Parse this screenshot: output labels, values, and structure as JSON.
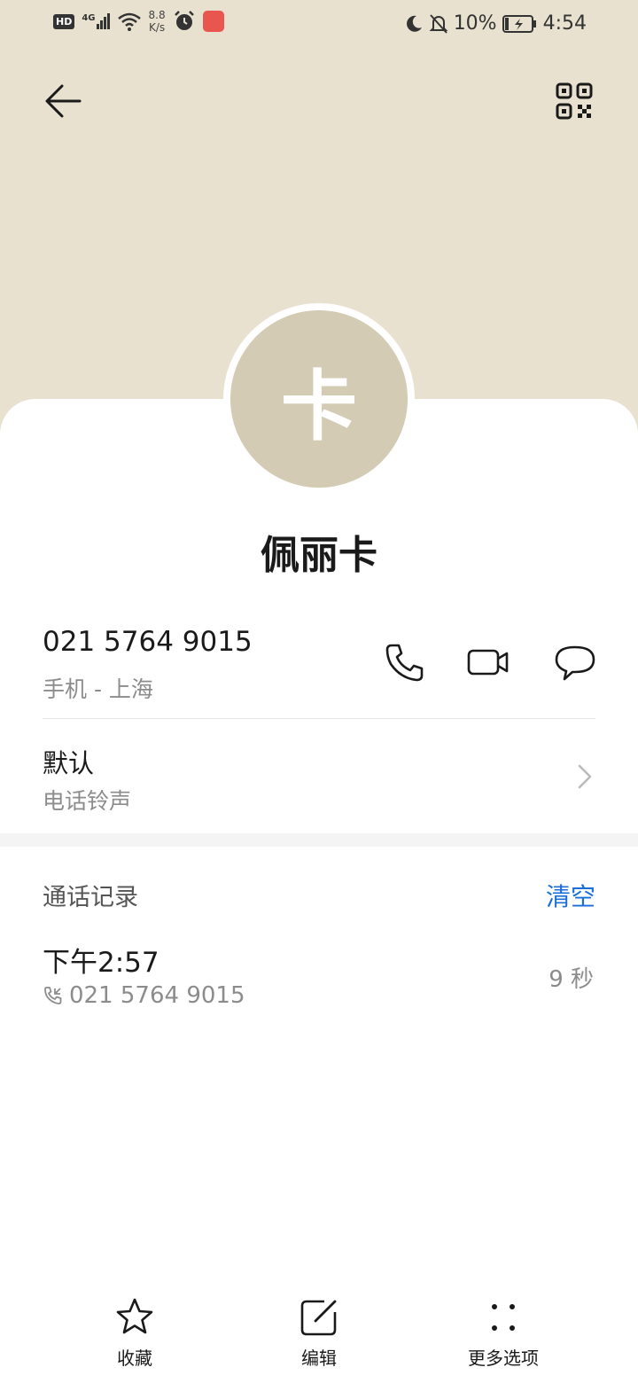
{
  "status_bar": {
    "hd": "HD",
    "network": "4G",
    "speed_value": "8.8",
    "speed_unit": "K/s",
    "battery": "10%",
    "time": "4:54"
  },
  "contact": {
    "avatar_char": "卡",
    "name": "佩丽卡",
    "phone": "021 5764 9015",
    "phone_meta": "手机 - 上海"
  },
  "ringtone": {
    "title": "默认",
    "subtitle": "电话铃声"
  },
  "call_log": {
    "header": "通话记录",
    "clear_label": "清空",
    "entries": [
      {
        "time": "下午2:57",
        "number": "021 5764 9015",
        "duration": "9 秒"
      }
    ]
  },
  "bottom_bar": {
    "favorite": "收藏",
    "edit": "编辑",
    "more": "更多选项"
  },
  "colors": {
    "header_bg": "#e8e1cf",
    "avatar_bg": "#d4cbb4",
    "accent": "#1a6ed8"
  },
  "icons": [
    "back-arrow-icon",
    "qr-code-icon",
    "phone-icon",
    "video-call-icon",
    "message-icon",
    "chevron-right-icon",
    "outgoing-call-icon",
    "star-icon",
    "edit-icon",
    "more-dots-icon"
  ]
}
